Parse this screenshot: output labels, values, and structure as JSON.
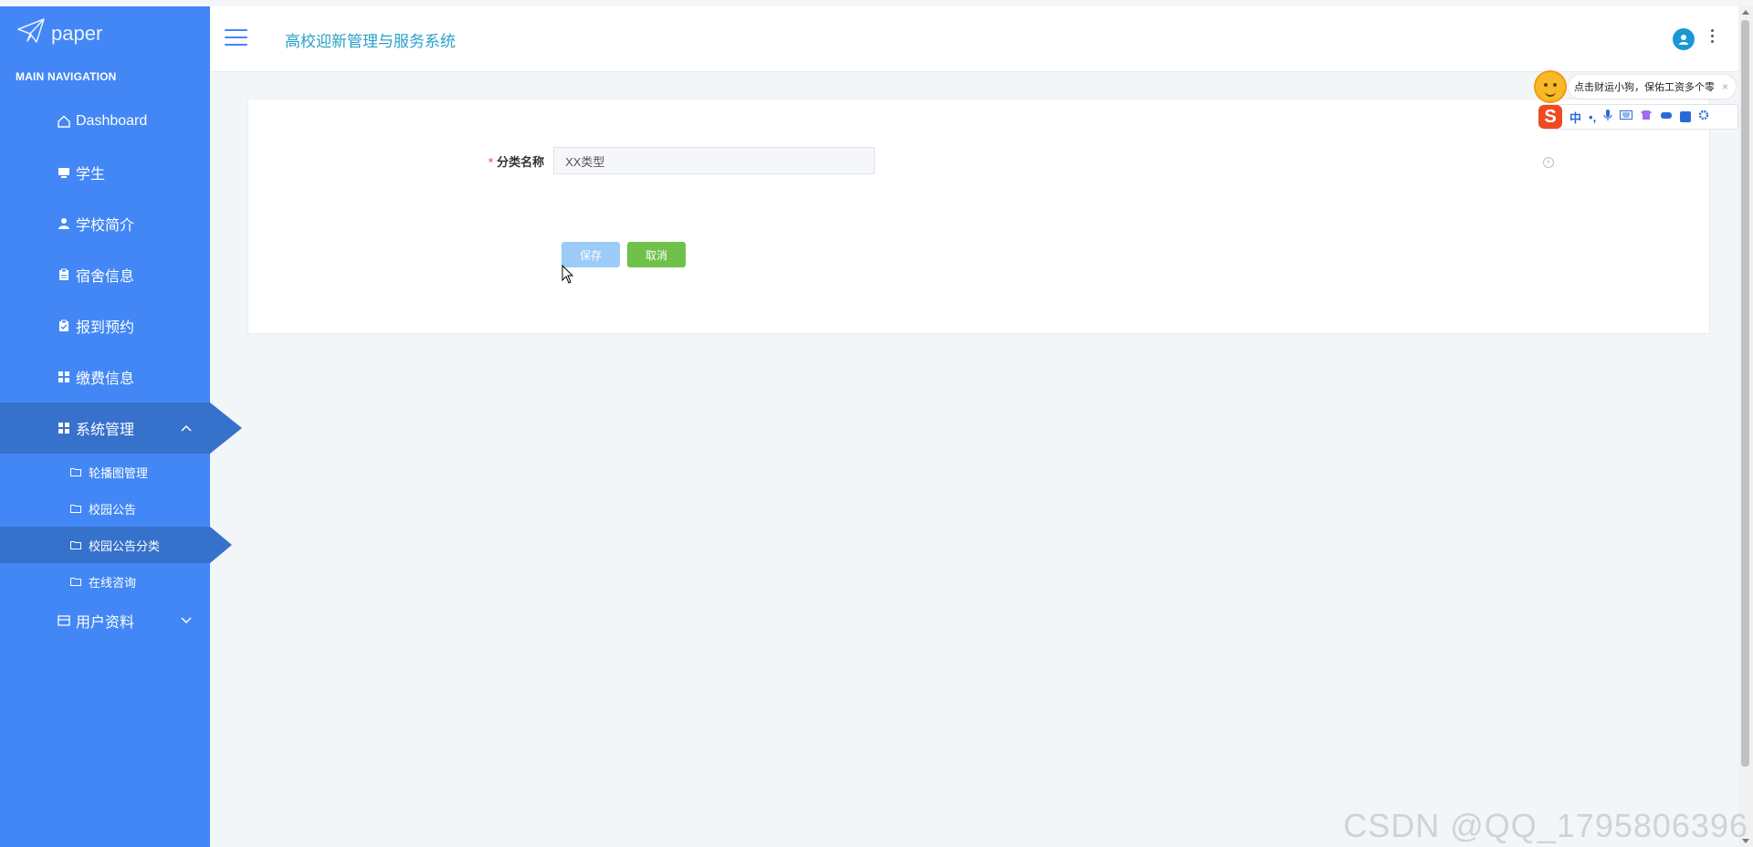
{
  "brand": {
    "name": "paper",
    "logo_icon": "paper-plane-icon"
  },
  "sidebar": {
    "section_title": "MAIN NAVIGATION",
    "items": [
      {
        "label": "Dashboard",
        "icon": "home-icon"
      },
      {
        "label": "学生",
        "icon": "monitor-icon"
      },
      {
        "label": "学校简介",
        "icon": "user-icon"
      },
      {
        "label": "宿舍信息",
        "icon": "clipboard-icon"
      },
      {
        "label": "报到预约",
        "icon": "clipboard-check-icon"
      },
      {
        "label": "缴费信息",
        "icon": "grid-icon"
      },
      {
        "label": "系统管理",
        "icon": "grid-icon",
        "expanded": true
      },
      {
        "label": "用户资料",
        "icon": "id-card-icon",
        "expanded": false
      }
    ],
    "sub_items": [
      {
        "label": "轮播图管理",
        "icon": "folder-icon"
      },
      {
        "label": "校园公告",
        "icon": "folder-icon"
      },
      {
        "label": "校园公告分类",
        "icon": "folder-icon",
        "active": true
      },
      {
        "label": "在线咨询",
        "icon": "folder-icon"
      }
    ]
  },
  "header": {
    "title": "高校迎新管理与服务系统"
  },
  "form": {
    "field_label": "分类名称",
    "required_mark": "*",
    "field_value": "XX类型",
    "save_label": "保存",
    "cancel_label": "取消"
  },
  "ime": {
    "tip": "点击财运小狗，保佑工资多个零",
    "mode": "中",
    "punct": "•,",
    "logo": "S"
  },
  "watermark": "CSDN @QQ_1795806396",
  "colors": {
    "sidebar": "#4287f5",
    "sidebar_active": "#3671cc",
    "title": "#28a0c8",
    "save_button": "#9ccbf7",
    "cancel_button": "#6fc14c",
    "background": "#f3f6f9"
  }
}
